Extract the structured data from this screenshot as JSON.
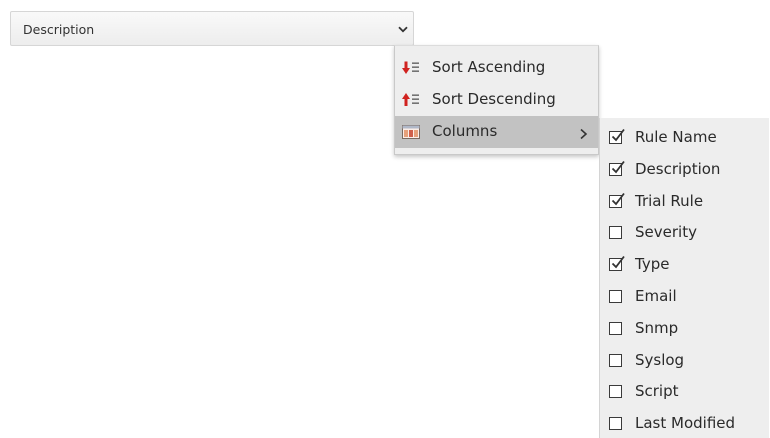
{
  "header": {
    "title": "Description",
    "trigger_icon": "chevron-down-icon"
  },
  "menu": {
    "items": [
      {
        "label": "Sort Ascending",
        "icon": "sort-ascending-icon",
        "icon_color": "#d0221f"
      },
      {
        "label": "Sort Descending",
        "icon": "sort-descending-icon",
        "icon_color": "#d0221f"
      },
      {
        "label": "Columns",
        "icon": "columns-icon",
        "has_submenu": true,
        "highlighted": true
      }
    ]
  },
  "columns_submenu": {
    "items": [
      {
        "label": "Rule Name",
        "checked": true
      },
      {
        "label": "Description",
        "checked": true
      },
      {
        "label": "Trial Rule",
        "checked": true
      },
      {
        "label": "Severity",
        "checked": false
      },
      {
        "label": "Type",
        "checked": true
      },
      {
        "label": "Email",
        "checked": false
      },
      {
        "label": "Snmp",
        "checked": false
      },
      {
        "label": "Syslog",
        "checked": false
      },
      {
        "label": "Script",
        "checked": false
      },
      {
        "label": "Last Modified",
        "checked": false
      }
    ]
  },
  "colors": {
    "menu_bg": "#eeeeee",
    "menu_highlight": "#c2c2c2",
    "sort_arrow_red": "#d0221f"
  }
}
